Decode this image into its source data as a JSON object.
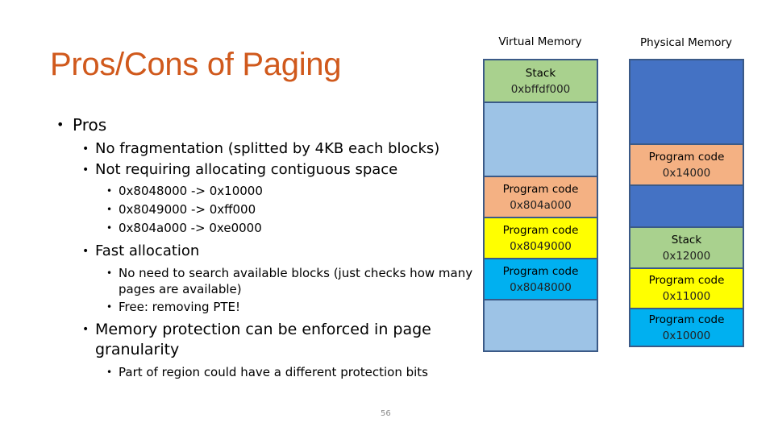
{
  "slide": {
    "title": "Pros/Cons of Paging",
    "page_number": "56",
    "bullets": {
      "pros": "Pros",
      "no_frag": "No fragmentation (splitted by 4KB each blocks)",
      "not_contig": "Not requiring allocating contiguous space",
      "mappings": [
        "0x8048000 -> 0x10000",
        "0x8049000 -> 0xff000",
        "0x804a000 -> 0xe0000"
      ],
      "fast_alloc": "Fast allocation",
      "no_search": "No need to search available blocks (just checks how many pages are available)",
      "free": "Free: removing PTE!",
      "mem_protect": "Memory protection can be enforced in page granularity",
      "part_region": "Part of region could have a different protection bits"
    }
  },
  "diagram": {
    "virtual": {
      "label": "Virtual Memory",
      "segments": [
        {
          "name": "Stack",
          "addr": "0xbffdf000",
          "color": "#a9d18e"
        },
        {
          "name": "",
          "addr": "",
          "color": "#9dc3e6"
        },
        {
          "name": "Program code",
          "addr": "0x804a000",
          "color": "#f4b183"
        },
        {
          "name": "Program code",
          "addr": "0x8049000",
          "color": "#ffff00"
        },
        {
          "name": "Program code",
          "addr": "0x8048000",
          "color": "#00b0f0"
        },
        {
          "name": "",
          "addr": "",
          "color": "#9dc3e6"
        }
      ]
    },
    "physical": {
      "label": "Physical Memory",
      "segments": [
        {
          "name": "",
          "addr": "",
          "color": "#4472c4"
        },
        {
          "name": "Program code",
          "addr": "0x14000",
          "color": "#f4b183"
        },
        {
          "name": "",
          "addr": "",
          "color": "#4472c4"
        },
        {
          "name": "Stack",
          "addr": "0x12000",
          "color": "#a9d18e"
        },
        {
          "name": "Program code",
          "addr": "0x11000",
          "color": "#ffff00"
        },
        {
          "name": "Program code",
          "addr": "0x10000",
          "color": "#00b0f0"
        }
      ]
    }
  }
}
